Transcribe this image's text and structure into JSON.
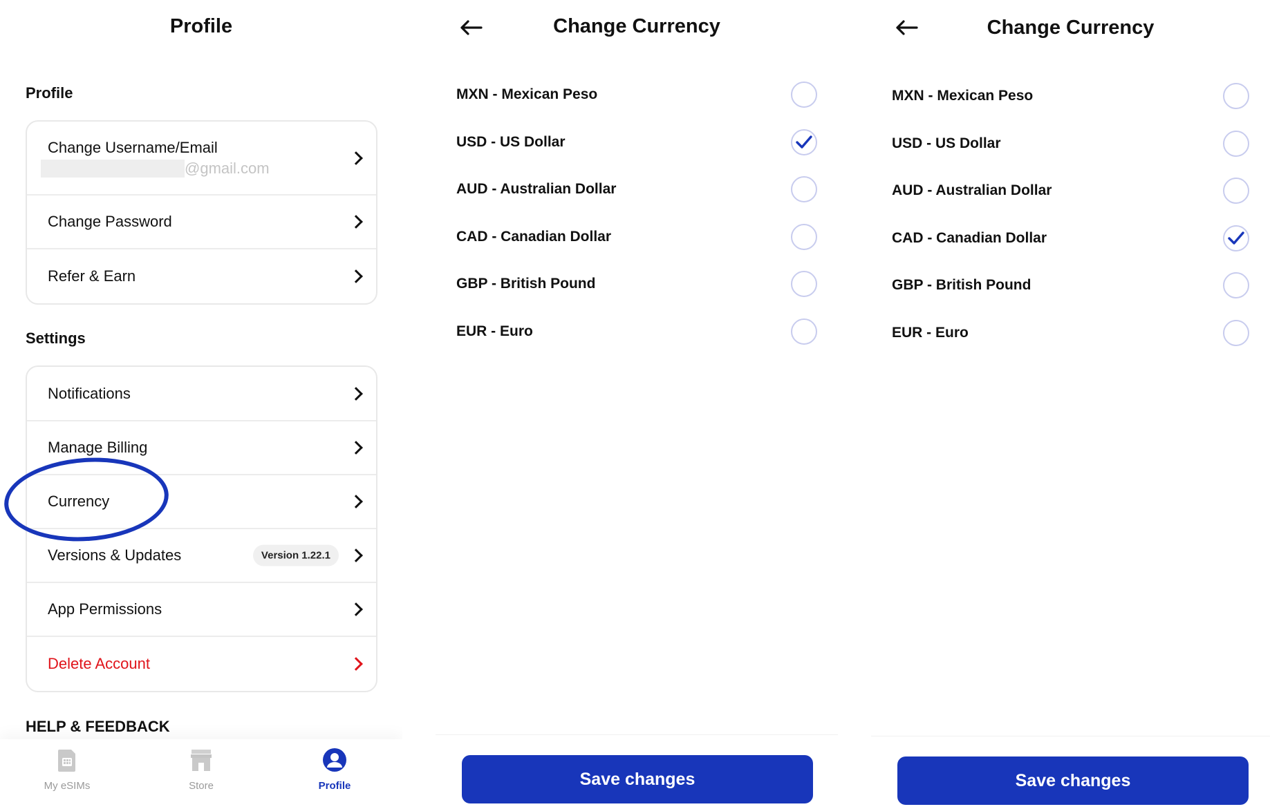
{
  "profile_screen": {
    "title": "Profile",
    "sections": {
      "profile_label": "Profile",
      "settings_label": "Settings",
      "help_label": "HELP & FEEDBACK"
    },
    "profile_items": [
      {
        "label": "Change Username/Email",
        "sublabel": "@gmail.com"
      },
      {
        "label": "Change Password"
      },
      {
        "label": "Refer & Earn"
      }
    ],
    "settings_items": [
      {
        "label": "Notifications"
      },
      {
        "label": "Manage Billing"
      },
      {
        "label": "Currency"
      },
      {
        "label": "Versions & Updates",
        "badge": "Version 1.22.1"
      },
      {
        "label": "App Permissions"
      },
      {
        "label": "Delete Account"
      }
    ],
    "tabs": [
      {
        "label": "My eSIMs",
        "icon": "sim-card-icon"
      },
      {
        "label": "Store",
        "icon": "store-icon"
      },
      {
        "label": "Profile",
        "icon": "user-icon",
        "active": true
      }
    ]
  },
  "currency_screen_1": {
    "title": "Change Currency",
    "options": [
      {
        "label": "MXN - Mexican Peso",
        "checked": false
      },
      {
        "label": "USD - US Dollar",
        "checked": true
      },
      {
        "label": "AUD - Australian Dollar",
        "checked": false
      },
      {
        "label": "CAD - Canadian Dollar",
        "checked": false
      },
      {
        "label": "GBP - British Pound",
        "checked": false
      },
      {
        "label": "EUR - Euro",
        "checked": false
      }
    ],
    "save_label": "Save changes"
  },
  "currency_screen_2": {
    "title": "Change Currency",
    "options": [
      {
        "label": "MXN - Mexican Peso",
        "checked": false
      },
      {
        "label": "USD - US Dollar",
        "checked": false
      },
      {
        "label": "AUD - Australian Dollar",
        "checked": false
      },
      {
        "label": "CAD - Canadian Dollar",
        "checked": true
      },
      {
        "label": "GBP - British Pound",
        "checked": false
      },
      {
        "label": "EUR - Euro",
        "checked": false
      }
    ],
    "save_label": "Save changes"
  },
  "colors": {
    "accent": "#1836ba",
    "danger": "#e0141b",
    "muted": "#9a9a9a"
  }
}
